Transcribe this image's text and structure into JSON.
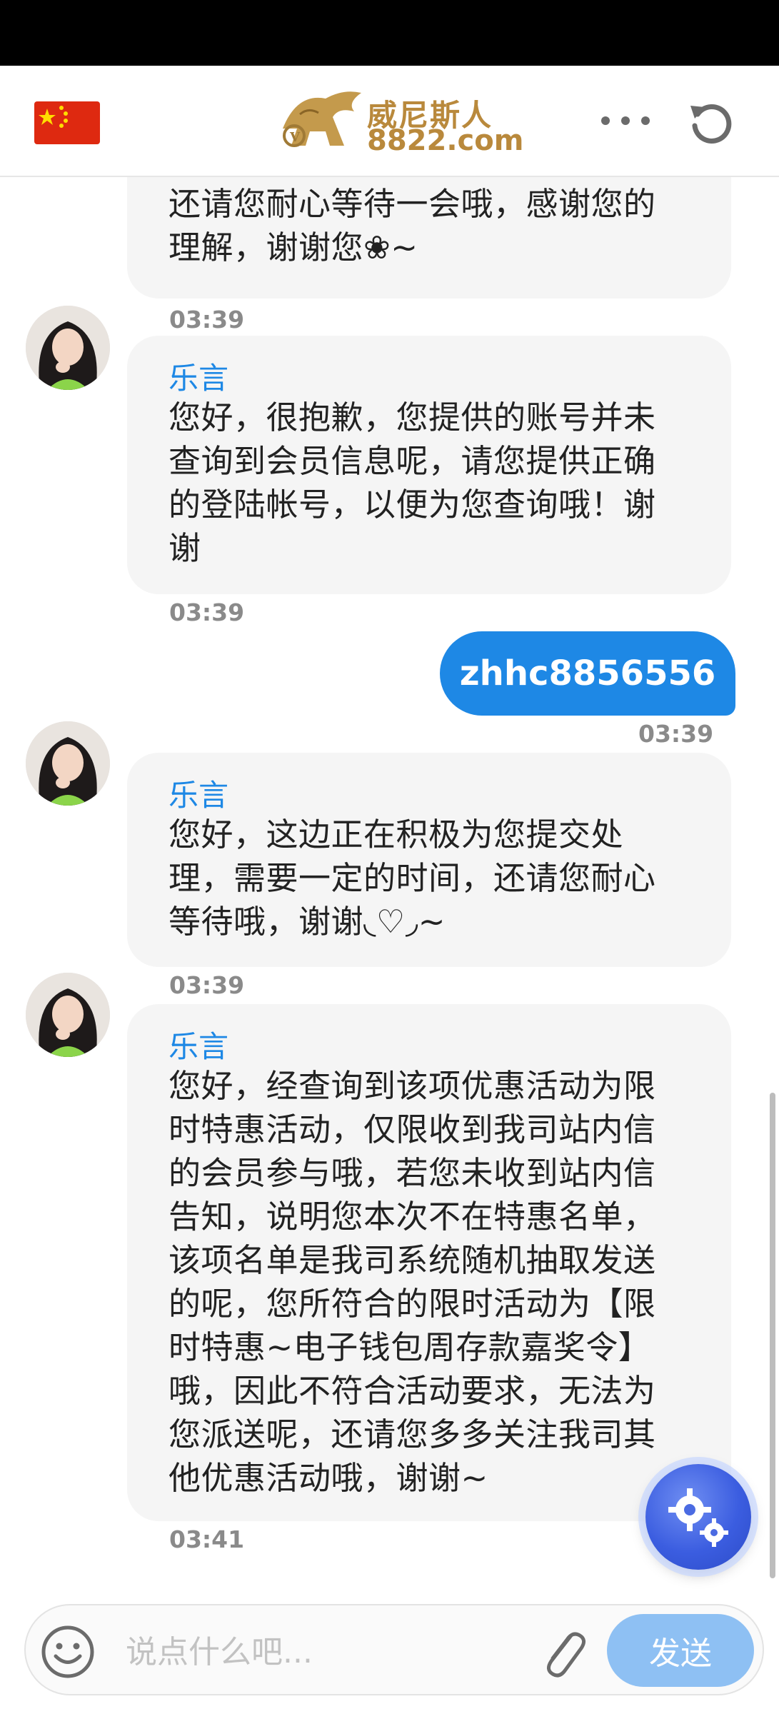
{
  "header": {
    "logo_cn": "威尼斯人",
    "logo_en": "8822.com"
  },
  "messages": [
    {
      "type": "agent-partial",
      "lines": [
        "还请您耐心等待一会哦，感谢您的",
        "理解，谢谢您❀~"
      ],
      "time": "03:39"
    },
    {
      "type": "agent",
      "sender": "乐言",
      "lines": [
        "您好，很抱歉，您提供的账号并未",
        "查询到会员信息呢，请您提供正确",
        "的登陆帐号，以便为您查询哦！谢",
        "谢"
      ],
      "time": "03:39"
    },
    {
      "type": "user",
      "text": "zhhc8856556",
      "time": "03:39"
    },
    {
      "type": "agent",
      "sender": "乐言",
      "lines": [
        "您好，这边正在积极为您提交处",
        "理，需要一定的时间，还请您耐心",
        "等待哦，谢谢◟♡◞~"
      ],
      "time": "03:39"
    },
    {
      "type": "agent",
      "sender": "乐言",
      "lines": [
        "您好，经查询到该项优惠活动为限",
        "时特惠活动，仅限收到我司站内信",
        "的会员参与哦，若您未收到站内信",
        "告知，说明您本次不在特惠名单，",
        "该项名单是我司系统随机抽取发送",
        "的呢，您所符合的限时活动为【限",
        "时特惠~电子钱包周存款嘉奖令】",
        "哦，因此不符合活动要求，无法为",
        "您派送呢，还请您多多关注我司其",
        "他优惠活动哦，谢谢~"
      ],
      "time": "03:41"
    }
  ],
  "input": {
    "placeholder": "说点什么吧...",
    "send_label": "发送"
  },
  "icons": {
    "flag": "china-flag-icon",
    "more": "more-dots-icon",
    "refresh": "refresh-icon",
    "fab": "gears-icon",
    "emoji": "emoji-icon",
    "attach": "paperclip-icon"
  },
  "colors": {
    "accent": "#1e88e5",
    "bubble": "#f5f5f5",
    "send_disabled": "#8ec0f3",
    "logo_gold": "#b9893c"
  }
}
